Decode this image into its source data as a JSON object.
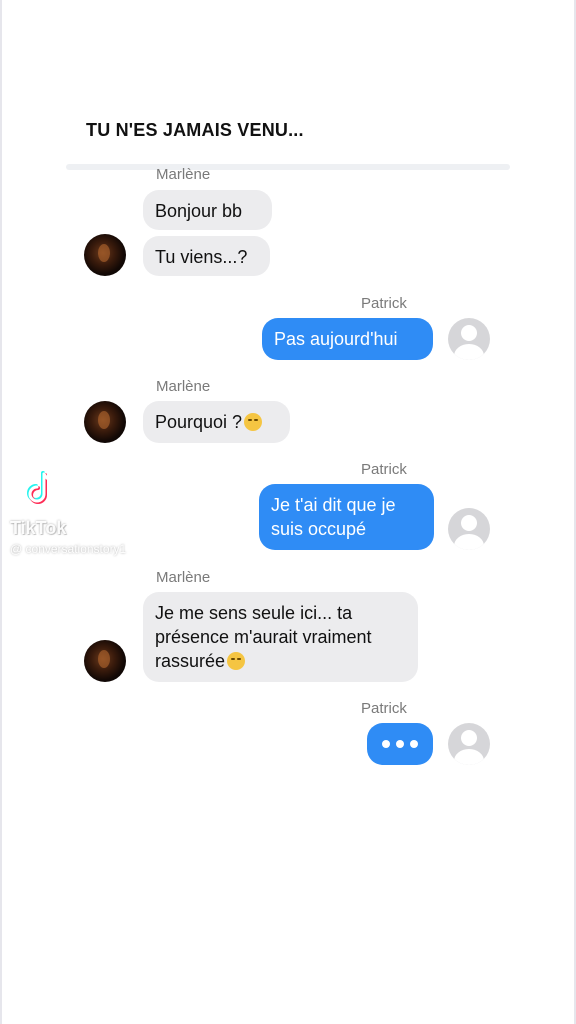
{
  "conversation": {
    "title": "TU N'ES JAMAIS VENU...",
    "messages": [
      {
        "sender": "Marlène",
        "text": "Bonjour bb"
      },
      {
        "sender": "Marlène",
        "text": "Tu viens...?"
      },
      {
        "sender": "Patrick",
        "text": "Pas aujourd'hui"
      },
      {
        "sender": "Marlène",
        "text": "Pourquoi ?",
        "emoji": "pleading-face"
      },
      {
        "sender": "Patrick",
        "text": "Je t'ai dit que je suis occupé"
      },
      {
        "sender": "Marlène",
        "text": "Je me sens seule ici... ta présence m'aurait vraiment rassurée",
        "emoji": "pensive-face"
      },
      {
        "sender": "Patrick",
        "typing": true
      }
    ],
    "names": {
      "marlene": "Marlène",
      "patrick": "Patrick"
    }
  },
  "watermark": {
    "brand": "TikTok",
    "handle": "@ conversationstory1"
  },
  "colors": {
    "outgoing_bubble": "#2f8cf5",
    "incoming_bubble": "#ececee"
  }
}
